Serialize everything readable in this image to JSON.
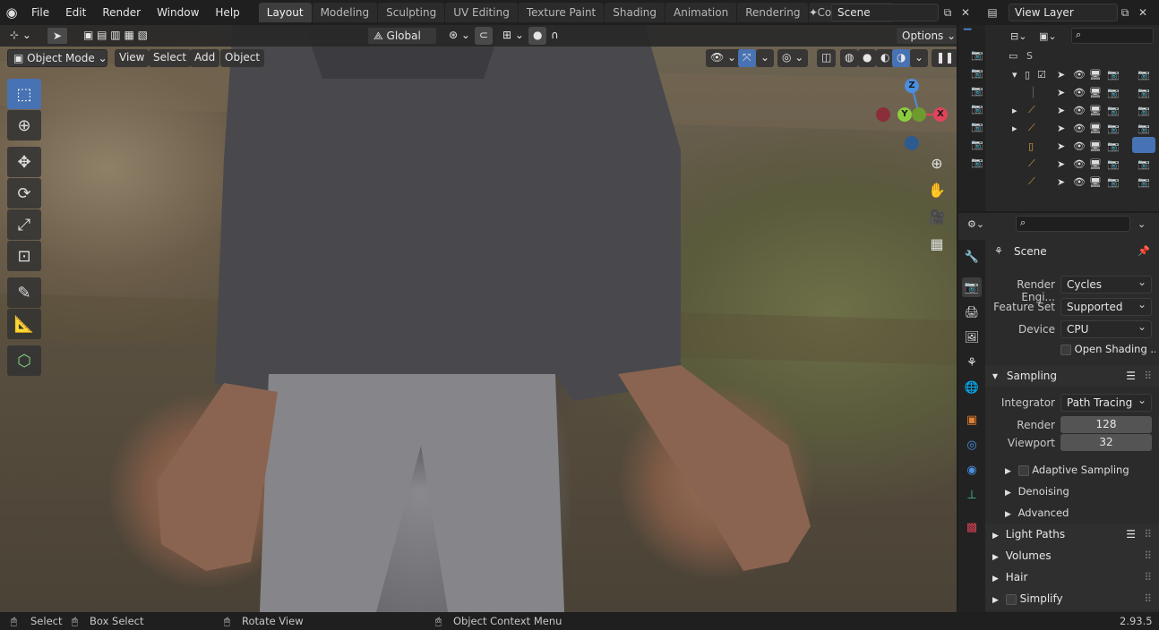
{
  "topbar": {
    "menus": [
      "File",
      "Edit",
      "Render",
      "Window",
      "Help"
    ],
    "workspaces": [
      "Layout",
      "Modeling",
      "Sculpting",
      "UV Editing",
      "Texture Paint",
      "Shading",
      "Animation",
      "Rendering",
      "Compositing"
    ],
    "active_workspace": "Layout",
    "scene_name": "Scene",
    "view_layer_name": "View Layer"
  },
  "viewport": {
    "transform_orientation": "Global",
    "options_label": "Options",
    "mode": "Object Mode",
    "menus": [
      "View",
      "Select",
      "Add",
      "Object"
    ],
    "gizmo_axes": {
      "z": "Z",
      "y": "Y",
      "x": "X"
    }
  },
  "outliner": {
    "search_placeholder": "",
    "scene_collection_label": "S"
  },
  "properties": {
    "context_title": "Scene",
    "render_engine_label": "Render Engi...",
    "render_engine": "Cycles",
    "feature_set_label": "Feature Set",
    "feature_set": "Supported",
    "device_label": "Device",
    "device": "CPU",
    "open_shading_label": "Open Shading ...",
    "sampling_label": "Sampling",
    "integrator_label": "Integrator",
    "integrator": "Path Tracing",
    "render_samples_label": "Render",
    "render_samples": "128",
    "viewport_samples_label": "Viewport",
    "viewport_samples": "32",
    "adaptive_sampling_label": "Adaptive Sampling",
    "denoising_label": "Denoising",
    "advanced_label": "Advanced",
    "light_paths_label": "Light Paths",
    "volumes_label": "Volumes",
    "hair_label": "Hair",
    "simplify_label": "Simplify"
  },
  "statusbar": {
    "select": "Select",
    "box_select": "Box Select",
    "rotate_view": "Rotate View",
    "object_context_menu": "Object Context Menu",
    "version": "2.93.5"
  },
  "colors": {
    "accent": "#4772b3",
    "x_axis": "#e0445a",
    "y_axis": "#8ccc3f",
    "z_axis": "#4a8fe0"
  }
}
